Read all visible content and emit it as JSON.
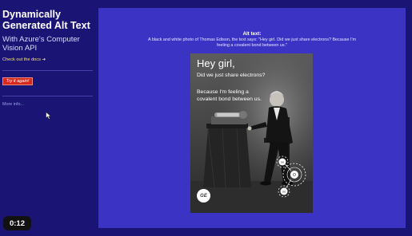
{
  "sidebar": {
    "title": "Dynamically Generated Alt Text",
    "subtitle": "With Azure's Computer Vision API",
    "docs_link": "Check out the docs ➜",
    "try_button": "Try it again!",
    "more_info": "More info..."
  },
  "main": {
    "alt_label": "Alt text:",
    "alt_description": "A black and white photo of Thomas Edison, the text says: \"Hey girl. Did we just share electrons? Because I'm feeling a covalent bond between us.\"",
    "photo": {
      "headline": "Hey girl,",
      "line2": "Did we just share electrons?",
      "line3": "Because I'm feeling a covalent bond between us.",
      "logo_text": "GE",
      "atom_labels": [
        "H",
        "O",
        "H"
      ]
    }
  },
  "video": {
    "timestamp": "0:12"
  },
  "colors": {
    "background": "#1a1474",
    "panel": "#3b33c4",
    "link": "#f5e36a",
    "button": "#d52b1e"
  }
}
